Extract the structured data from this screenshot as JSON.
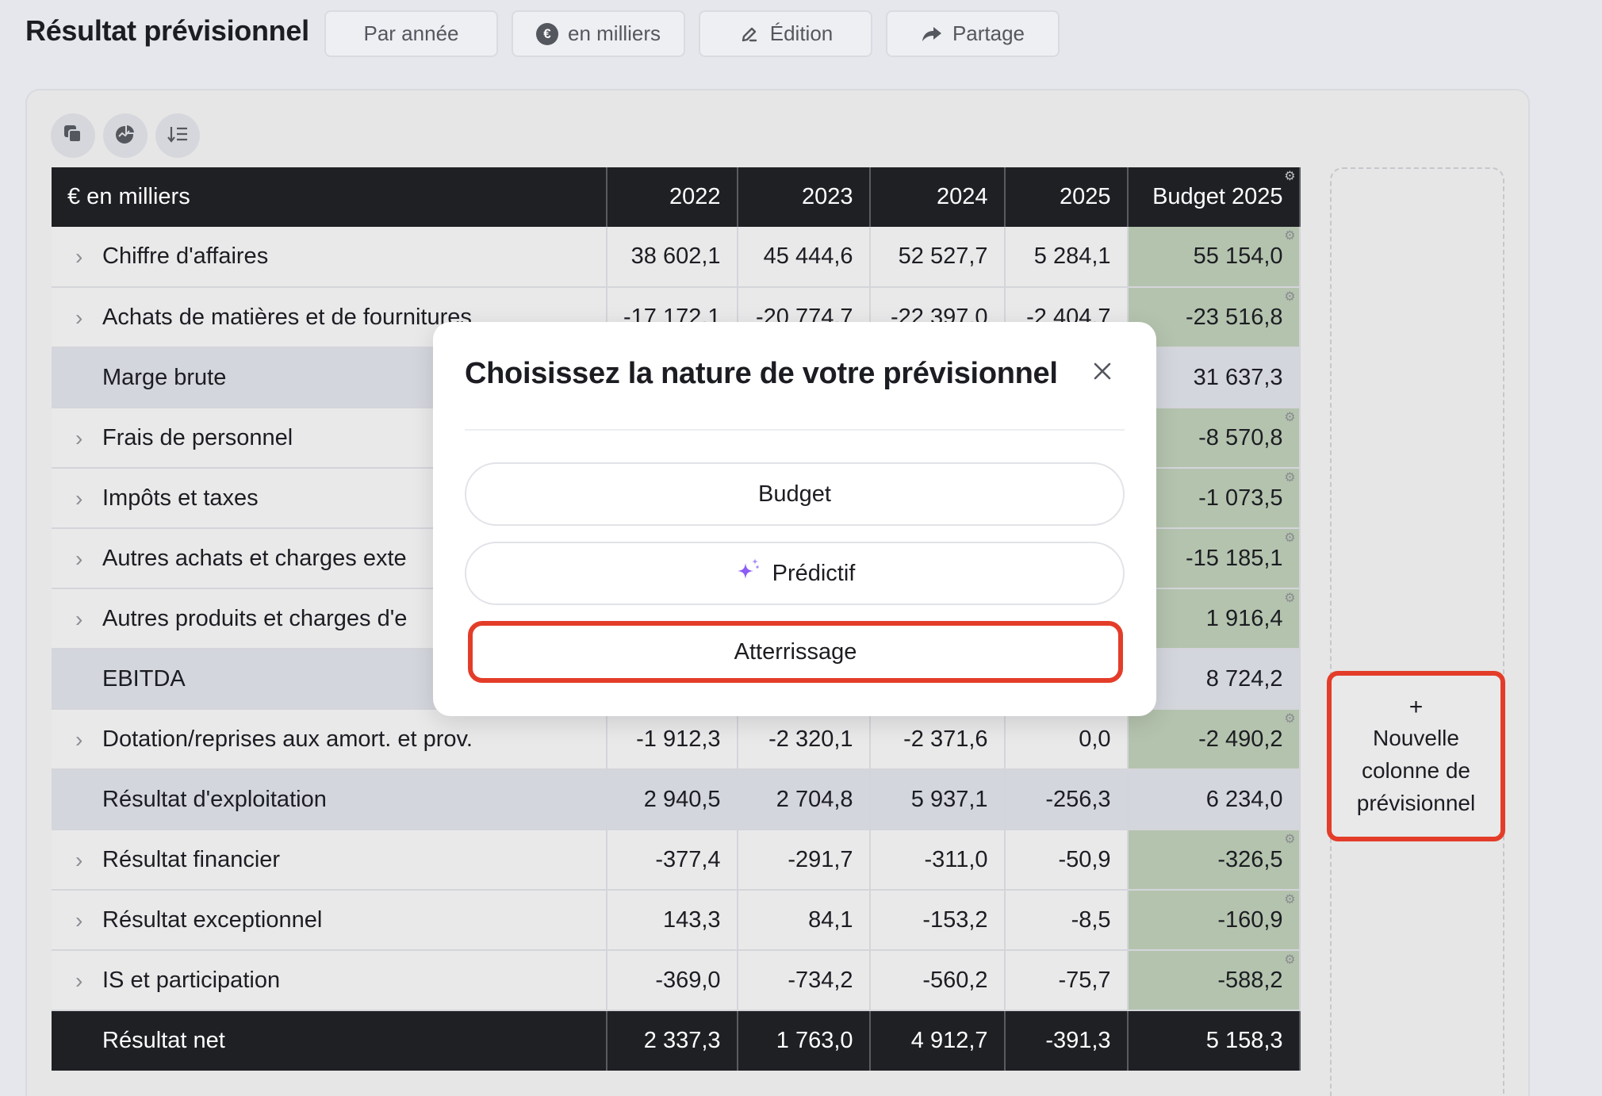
{
  "header": {
    "title": "Résultat prévisionnel",
    "buttons": {
      "par_annee": "Par année",
      "milliers": "en milliers",
      "edition": "Édition",
      "partage": "Partage"
    }
  },
  "table": {
    "columns": [
      "€ en milliers",
      "2022",
      "2023",
      "2024",
      "2025",
      "Budget 2025"
    ],
    "rows": [
      {
        "label": "Chiffre d'affaires",
        "values": [
          "38 602,1",
          "45 444,6",
          "52 527,7",
          "5 284,1",
          "55 154,0"
        ]
      },
      {
        "label": "Achats de matières et de fournitures",
        "values": [
          "-17 172,1",
          "-20 774,7",
          "-22 397,0",
          "-2 404,7",
          "-23 516,8"
        ]
      },
      {
        "label": "Marge brute",
        "values": [
          "",
          "",
          "",
          "",
          "31 637,3"
        ]
      },
      {
        "label": "Frais de personnel",
        "values": [
          "",
          "",
          "",
          "",
          "-8 570,8"
        ]
      },
      {
        "label": "Impôts et taxes",
        "values": [
          "",
          "",
          "",
          "",
          "-1 073,5"
        ]
      },
      {
        "label": "Autres achats et charges exte",
        "values": [
          "",
          "",
          "",
          "",
          "-15 185,1"
        ]
      },
      {
        "label": "Autres produits et charges d'e",
        "values": [
          "",
          "",
          "",
          "",
          "1 916,4"
        ]
      },
      {
        "label": "EBITDA",
        "values": [
          "",
          "",
          "",
          "",
          "8 724,2"
        ]
      },
      {
        "label": "Dotation/reprises aux amort. et prov.",
        "values": [
          "-1 912,3",
          "-2 320,1",
          "-2 371,6",
          "0,0",
          "-2 490,2"
        ]
      },
      {
        "label": "Résultat d'exploitation",
        "values": [
          "2 940,5",
          "2 704,8",
          "5 937,1",
          "-256,3",
          "6 234,0"
        ]
      },
      {
        "label": "Résultat financier",
        "values": [
          "-377,4",
          "-291,7",
          "-311,0",
          "-50,9",
          "-326,5"
        ]
      },
      {
        "label": "Résultat exceptionnel",
        "values": [
          "143,3",
          "84,1",
          "-153,2",
          "-8,5",
          "-160,9"
        ]
      },
      {
        "label": "IS et participation",
        "values": [
          "-369,0",
          "-734,2",
          "-560,2",
          "-75,7",
          "-588,2"
        ]
      },
      {
        "label": "Résultat net",
        "values": [
          "2 337,3",
          "1 763,0",
          "4 912,7",
          "-391,3",
          "5 158,3"
        ]
      }
    ]
  },
  "new_column": {
    "plus": "+",
    "line1": "Nouvelle",
    "line2": "colonne de",
    "line3": "prévisionnel"
  },
  "modal": {
    "title": "Choisissez la nature de votre prévisionnel",
    "options": {
      "budget": "Budget",
      "predictif": "Prédictif",
      "atterrissage": "Atterrissage"
    }
  },
  "colors": {
    "highlight": "#e33d2a",
    "budget_cell": "#b4c3ae",
    "header_bg": "#1f2024",
    "sparkle": "#8b5cf6"
  }
}
